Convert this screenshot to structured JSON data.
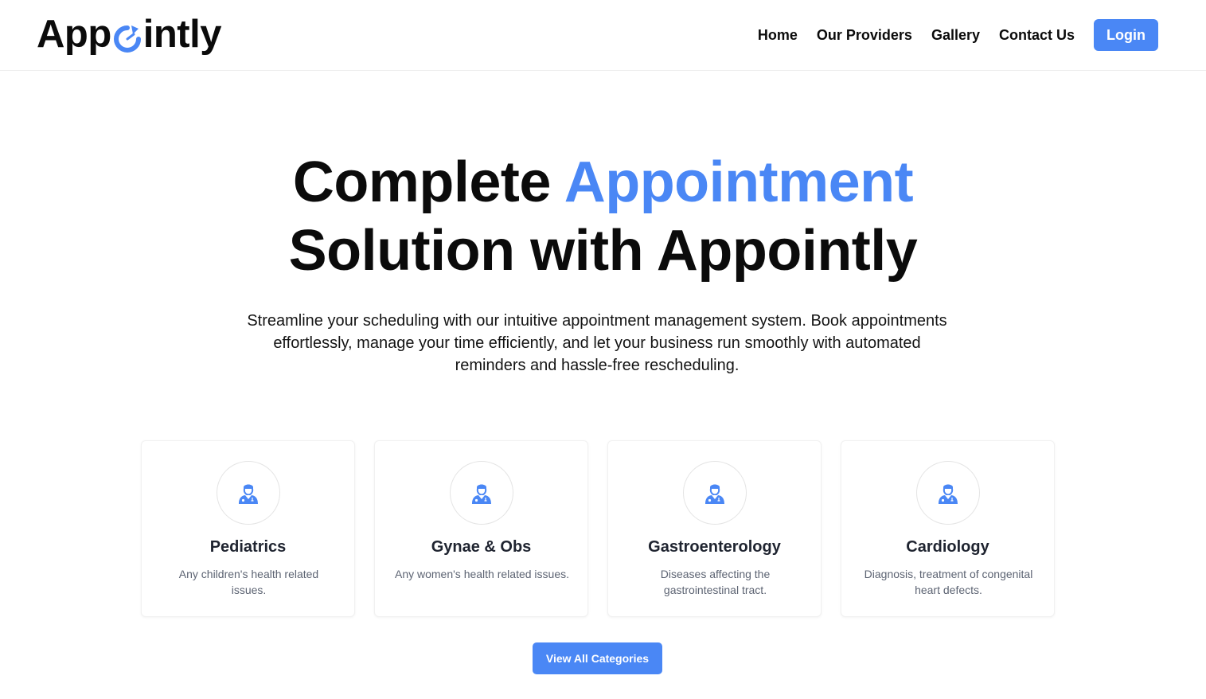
{
  "brand": {
    "name_prefix": "App",
    "name_suffix": "intly",
    "accent_color": "#4a87f5"
  },
  "nav": {
    "items": [
      {
        "label": "Home"
      },
      {
        "label": "Our Providers"
      },
      {
        "label": "Gallery"
      },
      {
        "label": "Contact Us"
      }
    ],
    "login_label": "Login"
  },
  "hero": {
    "title_part1": "Complete ",
    "title_accent": "Appointment",
    "title_part2": "Solution with Appointly",
    "subtitle": "Streamline your scheduling with our intuitive appointment management system. Book appointments effortlessly, manage your time efficiently, and let your business run smoothly with automated reminders and hassle-free rescheduling."
  },
  "categories": [
    {
      "title": "Pediatrics",
      "description": "Any children's health related issues.",
      "icon": "doctor-icon"
    },
    {
      "title": "Gynae & Obs",
      "description": "Any women's health related issues.",
      "icon": "doctor-icon"
    },
    {
      "title": "Gastroenterology",
      "description": "Diseases affecting the gastrointestinal tract.",
      "icon": "doctor-icon"
    },
    {
      "title": "Cardiology",
      "description": "Diagnosis, treatment of congenital heart defects.",
      "icon": "doctor-icon"
    }
  ],
  "cta": {
    "label": "View All Categories"
  }
}
